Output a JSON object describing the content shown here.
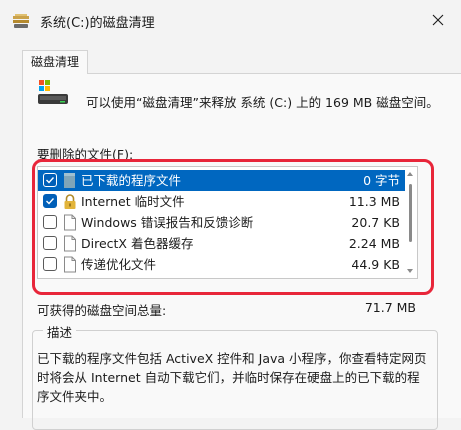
{
  "window": {
    "title": "系统(C:)的磁盘清理",
    "title_icon": "disk-cleanup-icon",
    "close_icon": "close-icon"
  },
  "tab": {
    "label": "磁盘清理"
  },
  "intro": {
    "drive_icon": "drive-icon",
    "text": "可以使用“磁盘清理”来释放 系统 (C:) 上的 169 MB 磁盘空间。"
  },
  "files": {
    "label": "要删除的文件(F):",
    "items": [
      {
        "name": "已下载的程序文件",
        "size": "0 字节",
        "checked": true,
        "selected": true,
        "icon": "folder-icon"
      },
      {
        "name": "Internet 临时文件",
        "size": "11.3 MB",
        "checked": true,
        "selected": false,
        "icon": "lock-icon"
      },
      {
        "name": "Windows 错误报告和反馈诊断",
        "size": "20.7 KB",
        "checked": false,
        "selected": false,
        "icon": "file-icon"
      },
      {
        "name": "DirectX 着色器缓存",
        "size": "2.24 MB",
        "checked": false,
        "selected": false,
        "icon": "file-icon"
      },
      {
        "name": "传递优化文件",
        "size": "44.9 KB",
        "checked": false,
        "selected": false,
        "icon": "file-icon"
      }
    ]
  },
  "total": {
    "label": "可获得的磁盘空间总量:",
    "value": "71.7 MB"
  },
  "description": {
    "legend": "描述",
    "text": "已下载的程序文件包括 ActiveX 控件和 Java 小程序，你查看特定网页时将会从 Internet 自动下载它们，并临时保存在硬盘上的已下载的程序文件夹中。"
  },
  "colors": {
    "selection": "#0067c0",
    "checkbox": "#005fb8",
    "highlight": "#e8263a"
  }
}
